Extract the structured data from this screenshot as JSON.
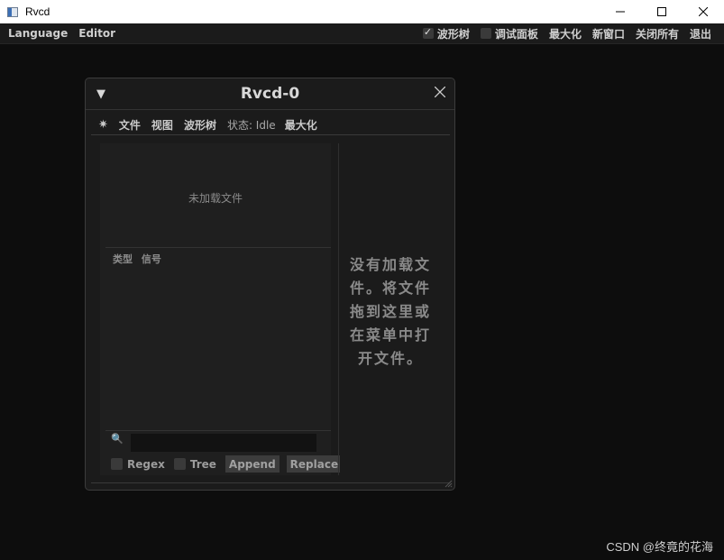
{
  "window": {
    "title": "Rvcd"
  },
  "menubar": {
    "left": [
      "Language",
      "Editor"
    ],
    "waveform_tree": {
      "label": "波形树",
      "checked": true
    },
    "debug_panel": {
      "label": "调试面板",
      "checked": false
    },
    "right": [
      "最大化",
      "新窗口",
      "关闭所有",
      "退出"
    ]
  },
  "subwindow": {
    "title": "Rvcd-0",
    "menu": {
      "gear": "✷",
      "items": [
        "文件",
        "视图",
        "波形树"
      ],
      "status": "状态: Idle",
      "maximize": "最大化"
    },
    "no_file": "未加载文件",
    "columns": [
      "类型",
      "信号"
    ],
    "search": {
      "icon": "🔍",
      "value": ""
    },
    "options": {
      "regex": "Regex",
      "tree": "Tree"
    },
    "buttons": {
      "append": "Append",
      "replace": "Replace"
    },
    "drop_message": "没有加载文件。将文件拖到这里或在菜单中打开文件。"
  },
  "watermark": "CSDN @终竟的花海"
}
